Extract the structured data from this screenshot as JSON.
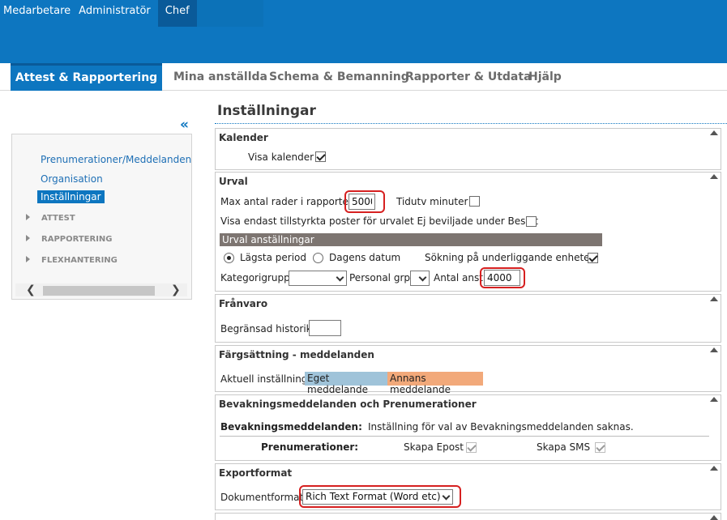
{
  "roles": [
    "Medarbetare",
    "Administratör",
    "Chef"
  ],
  "nav": {
    "active": "Attest & Rapportering",
    "items": [
      "Mina anställda",
      "Schema & Bemanning",
      "Rapporter & Utdata",
      "Hjälp"
    ]
  },
  "sidebar": {
    "collapse_icon": "«",
    "links": [
      "Prenumerationer/Meddelanden",
      "Organisation",
      "Inställningar"
    ],
    "groups": [
      "ATTEST",
      "RAPPORTERING",
      "FLEXHANTERING"
    ],
    "scroll_left": "❮",
    "scroll_right": "❯"
  },
  "page_title": "Inställningar",
  "kalender": {
    "title": "Kalender",
    "visa_label": "Visa kalender",
    "visa_checked": true
  },
  "urval": {
    "title": "Urval",
    "max_label": "Max antal rader i rapporter",
    "max_value": "5000",
    "tidutv_label": "Tidutv minuter",
    "tidutv_checked": false,
    "visa_endast_label": "Visa endast tillstyrkta poster för urvalet Ej beviljade under Beslut",
    "visa_endast_checked": false,
    "settings_header": "Urval anställningar",
    "radio1": "Lägsta period",
    "radio2": "Dagens datum",
    "sokning_label": "Sökning på underliggande enheter",
    "sokning_checked": true,
    "kategori_label": "Kategorigrupp",
    "kategori_value": "",
    "personal_label": "Personal grp",
    "personal_value": "",
    "antal_label": "Antal anst",
    "antal_value": "4000"
  },
  "franvaro": {
    "title": "Frånvaro",
    "historik_label": "Begränsad historik",
    "historik_value": ""
  },
  "fargsattning": {
    "title": "Färgsättning - meddelanden",
    "current_label": "Aktuell inställning",
    "own_label": "Eget meddelande",
    "own_color": "#9fc3d9",
    "other_label": "Annans meddelande",
    "other_color": "#f2a97a"
  },
  "bevakning": {
    "title": "Bevakningsmeddelanden och Prenumerationer",
    "bev_label": "Bevakningsmeddelanden:",
    "bev_text": "Inställning för val av Bevakningsmeddelanden saknas.",
    "pren_label": "Prenumerationer:",
    "epost_label": "Skapa Epost",
    "epost_checked": true,
    "sms_label": "Skapa SMS",
    "sms_checked": true
  },
  "export": {
    "title": "Exportformat",
    "doc_label": "Dokumentformat",
    "doc_value": "Rich Text Format (Word etc)"
  },
  "colors": {
    "brand_blue": "#0d76c0",
    "highlight_red": "#d62020"
  }
}
